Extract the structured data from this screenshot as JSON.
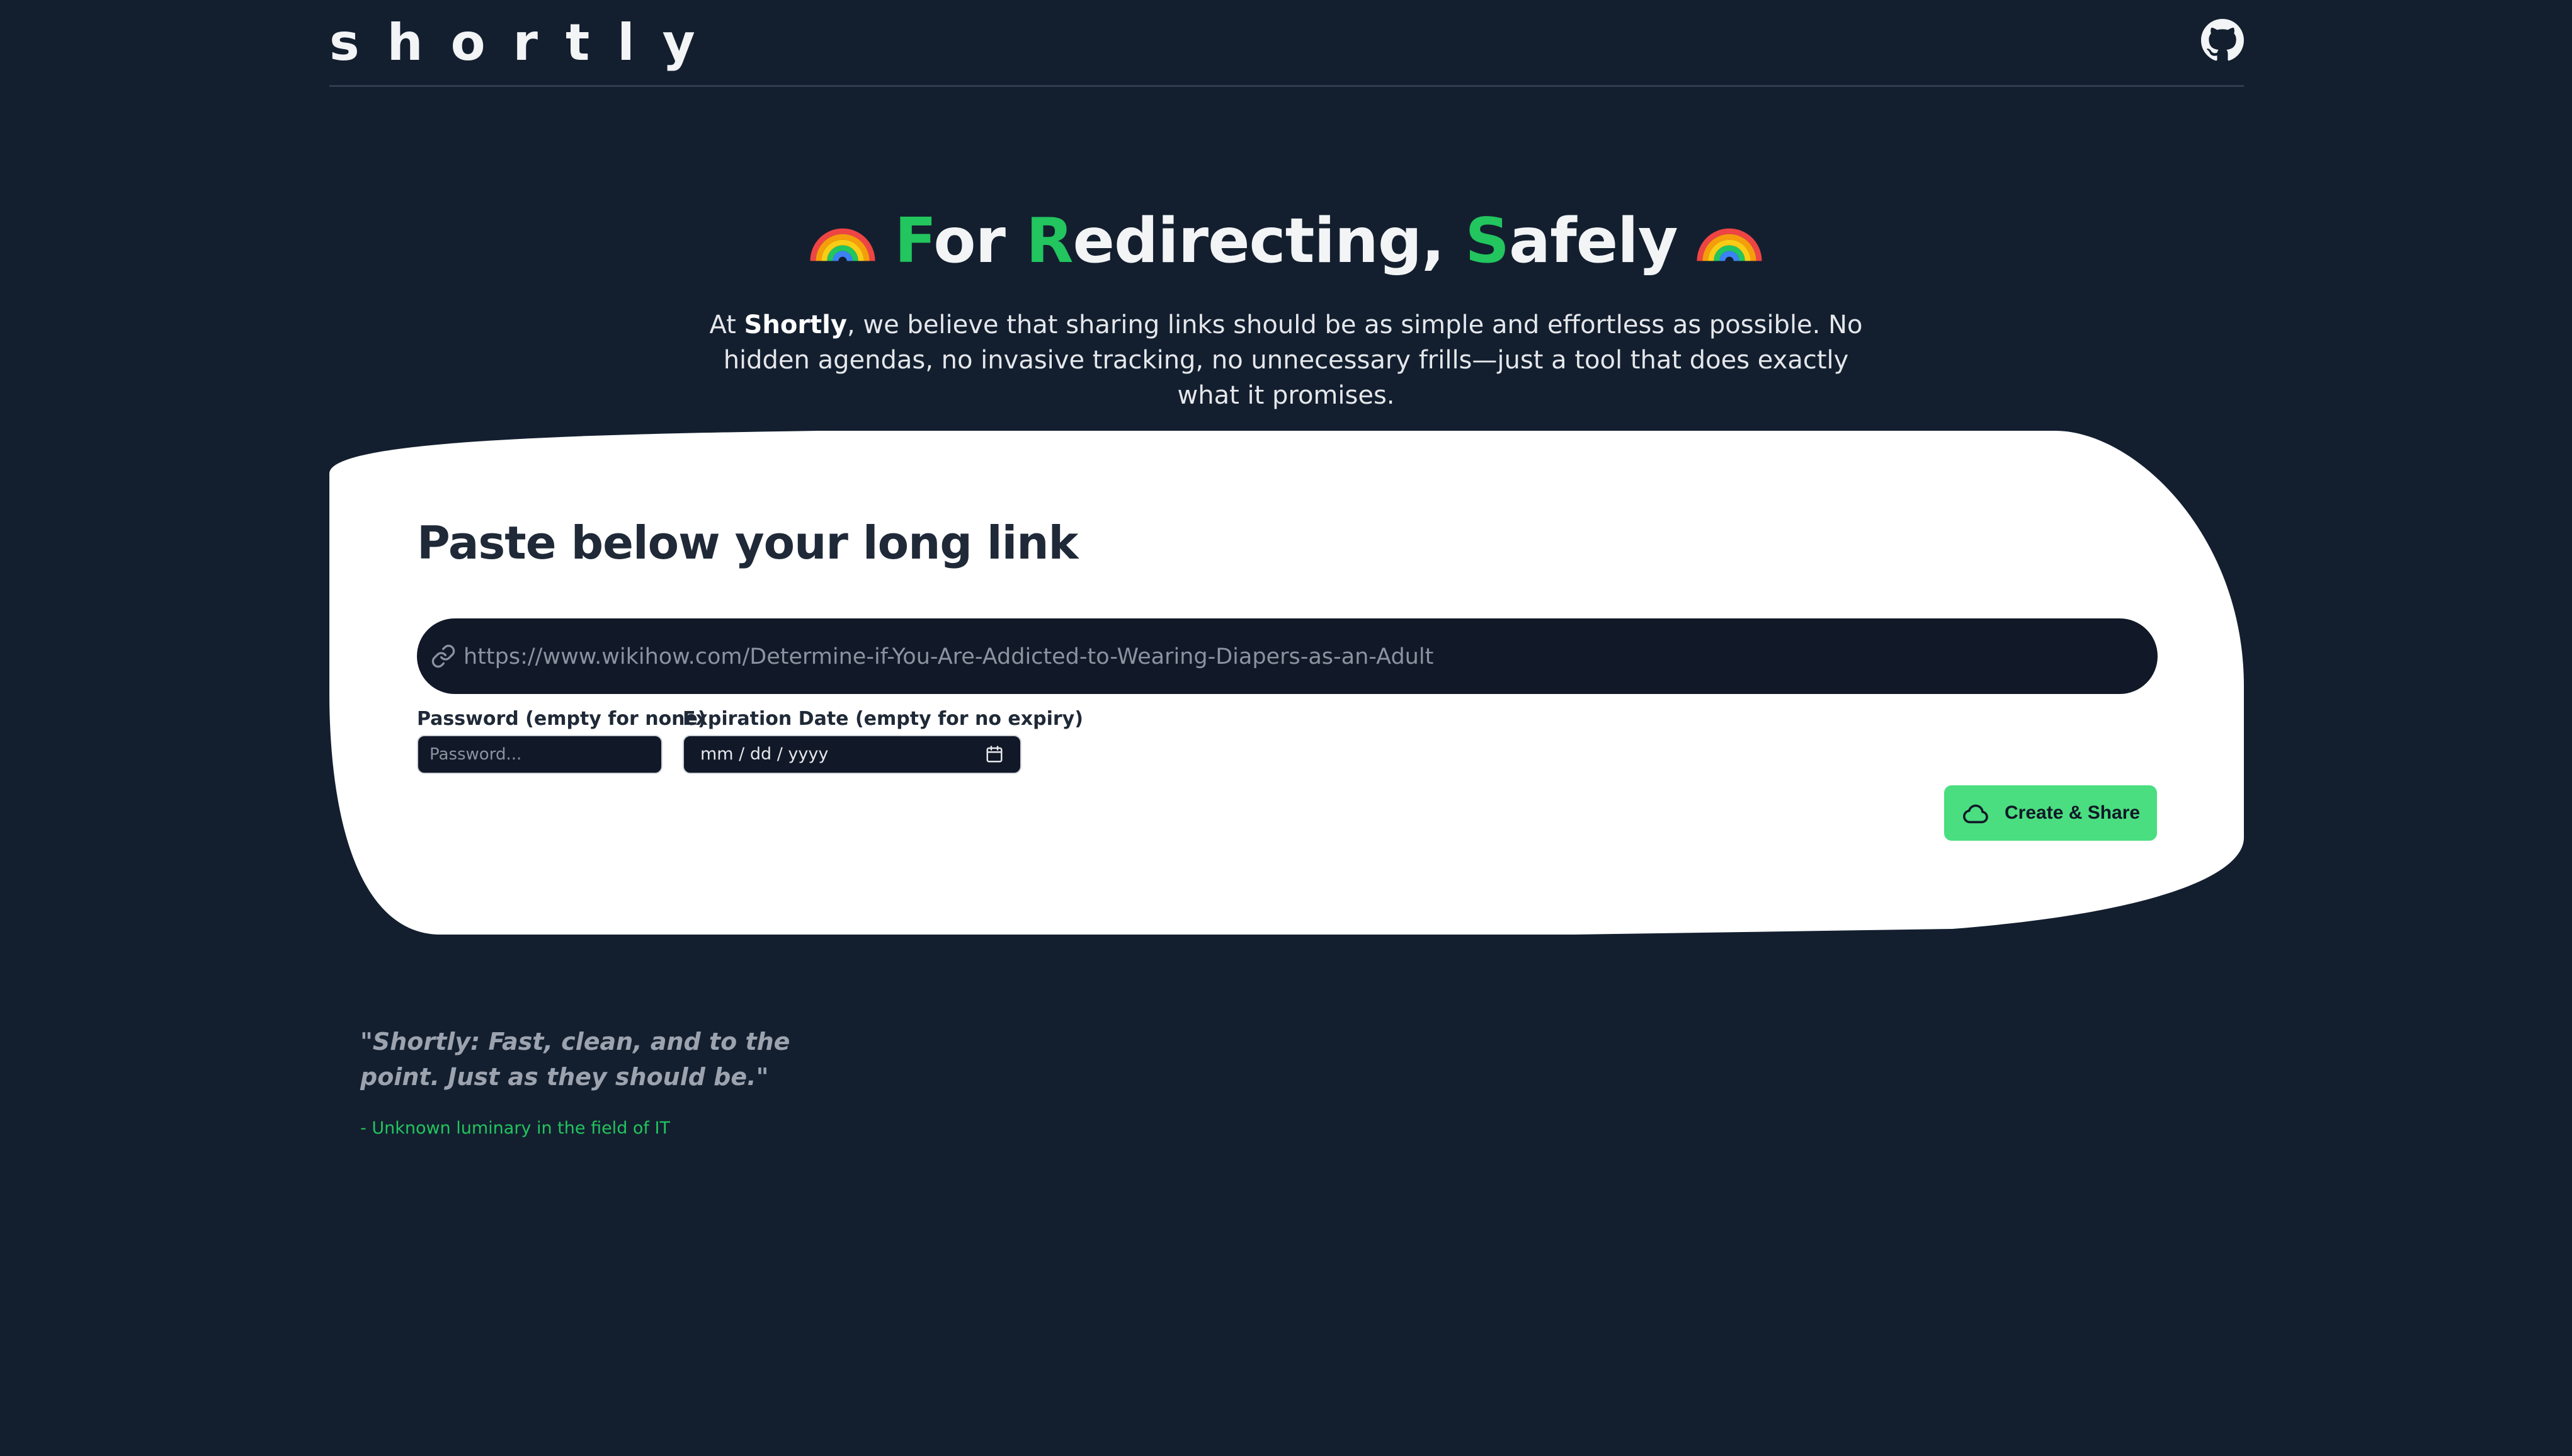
{
  "header": {
    "logo_text": "shortly",
    "github_icon": "github-icon"
  },
  "hero": {
    "title_parts": [
      {
        "text": "F",
        "highlight": true
      },
      {
        "text": "or ",
        "highlight": false
      },
      {
        "text": "R",
        "highlight": true
      },
      {
        "text": "edirecting, ",
        "highlight": false
      },
      {
        "text": "S",
        "highlight": true
      },
      {
        "text": "afely",
        "highlight": false
      }
    ],
    "rainbow_icon": "rainbow-icon",
    "description_prefix": "At ",
    "description_brand": "Shortly",
    "description_rest": ", we believe that sharing links should be as simple and effortless as possible. No hidden agendas, no invasive tracking, no unnecessary frills—just a tool that does exactly what it promises."
  },
  "card": {
    "heading": "Paste below your long link",
    "url_placeholder": "https://www.wikihow.com/Determine-if-You-Are-Addicted-to-Wearing-Diapers-as-an-Adult",
    "password_label": "Password (empty for none)",
    "password_placeholder": "Password...",
    "expiration_label": "Expiration Date (empty for no expiry)",
    "date_placeholder": "mm / dd / yyyy",
    "create_button": "Create & Share"
  },
  "quote": {
    "text": "\"Shortly: Fast, clean, and to the point. Just as they should be.\"",
    "author": "- Unknown luminary in the field of IT"
  },
  "colors": {
    "background": "#131f2f",
    "accent_green": "#22c55e",
    "button_green": "#4ade80",
    "card_bg": "#ffffff",
    "input_bg": "#111827"
  }
}
